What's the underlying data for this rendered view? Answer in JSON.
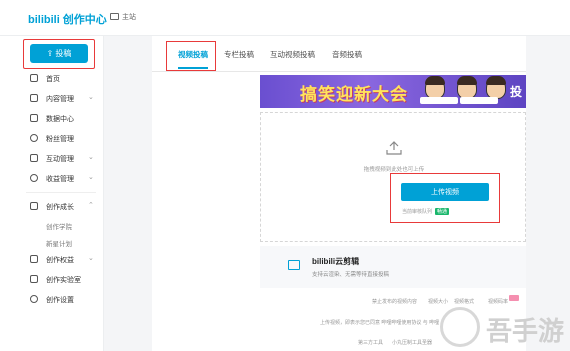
{
  "topbar": {
    "logo_brand": "bilibili",
    "logo_title": "创作中心",
    "home_label": "主站"
  },
  "sidebar": {
    "upload_label": "投稿",
    "items": [
      {
        "label": "首页",
        "icon": "home-icon"
      },
      {
        "label": "内容管理",
        "icon": "document-icon",
        "chevron": "⌄"
      },
      {
        "label": "数据中心",
        "icon": "chart-icon"
      },
      {
        "label": "粉丝管理",
        "icon": "user-icon"
      },
      {
        "label": "互动管理",
        "icon": "chat-icon",
        "chevron": "⌄"
      },
      {
        "label": "收益管理",
        "icon": "coin-icon",
        "chevron": "⌄"
      },
      {
        "label": "创作成长",
        "icon": "graduation-icon",
        "chevron": "⌃"
      },
      {
        "label": "创作权益",
        "icon": "gift-icon",
        "chevron": "⌄"
      },
      {
        "label": "创作实验室",
        "icon": "flask-icon"
      },
      {
        "label": "创作设置",
        "icon": "gear-icon"
      }
    ],
    "growth_sub": [
      "创作学院",
      "新星计划"
    ]
  },
  "tabs": [
    {
      "label": "视频投稿",
      "active": true
    },
    {
      "label": "专栏投稿",
      "active": false
    },
    {
      "label": "互动视频投稿",
      "active": false
    },
    {
      "label": "音频投稿",
      "active": false
    }
  ],
  "banner": {
    "title": "搞笑迎新大会",
    "right_text": "投"
  },
  "dropzone": {
    "hint": "拖拽视频到此处也可上传",
    "upload_button": "上传视频",
    "queue_label": "当前审核队列",
    "queue_status": "畅通"
  },
  "cloud_editor": {
    "title": "bilibili云剪辑",
    "subtitle": "支持云渲染、无需等待直接投稿"
  },
  "footer": {
    "row1": [
      "禁止发布的视频内容",
      "视频大小",
      "视频格式",
      "视频码率"
    ],
    "row2": "上传视频，即表示您已同意 哔哩哔哩使用协议 与 哔哩",
    "row3": [
      "第三方工具",
      "小丸压制工具圣器"
    ]
  },
  "colors": {
    "accent": "#00a1d6",
    "highlight_box": "#e83a3a",
    "status_green": "#19b66b"
  }
}
